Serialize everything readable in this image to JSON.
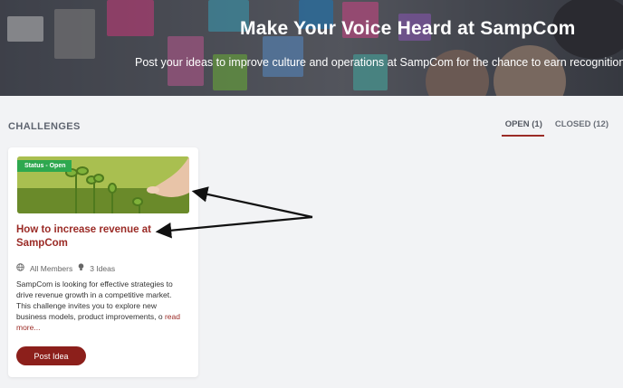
{
  "hero": {
    "title": "Make Your Voice Heard at SampCom",
    "subtitle": "Post your ideas to improve culture and operations at SampCom for the chance to earn recognition a"
  },
  "section": {
    "title": "CHALLENGES"
  },
  "tabs": [
    {
      "label": "OPEN (1)",
      "active": true
    },
    {
      "label": "CLOSED (12)",
      "active": false
    }
  ],
  "card": {
    "badge": "Status - Open",
    "title": "How to increase revenue at SampCom",
    "audience_icon": "globe-icon",
    "audience": "All Members",
    "ideas_icon": "lightbulb-icon",
    "ideas": "3 Ideas",
    "description": "SampCom is looking for effective strategies to drive revenue growth in a competitive market. This challenge invites you to explore new business models, product improvements, o ",
    "read_more": "read more...",
    "button": "Post Idea"
  },
  "colors": {
    "accent": "#9b2b26",
    "button": "#8c1f1b",
    "status": "#2ea84f"
  }
}
